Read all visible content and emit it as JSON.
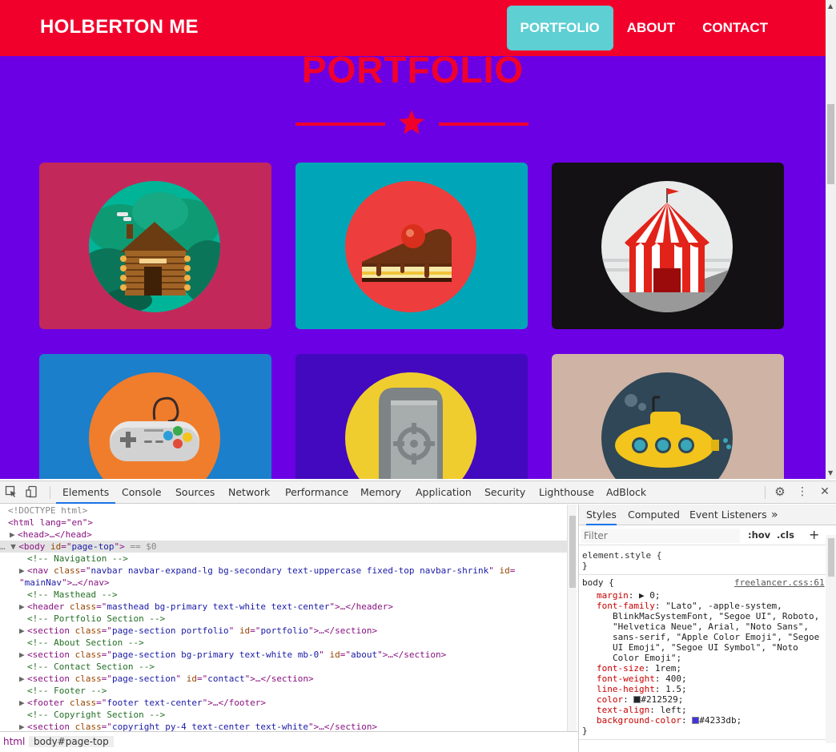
{
  "site": {
    "brand": "HOLBERTON ME",
    "nav": [
      {
        "label": "PORTFOLIO",
        "active": true
      },
      {
        "label": "ABOUT",
        "active": false
      },
      {
        "label": "CONTACT",
        "active": false
      }
    ],
    "section_title": "PORTFOLIO",
    "colors": {
      "navbar": "#f1002c",
      "body": "#6c00e4",
      "accent": "#5ecfd3"
    },
    "cards": [
      {
        "name": "cabin",
        "bg": "#c2295a"
      },
      {
        "name": "cake",
        "bg": "#00a6b8"
      },
      {
        "name": "circus",
        "bg": "#141114"
      },
      {
        "name": "game",
        "bg": "#1b7fcb"
      },
      {
        "name": "safe",
        "bg": "#4209bf"
      },
      {
        "name": "submarine",
        "bg": "#cfb3a5"
      }
    ]
  },
  "devtools": {
    "tabs": [
      "Elements",
      "Console",
      "Sources",
      "Network",
      "Performance",
      "Memory",
      "Application",
      "Security",
      "Lighthouse",
      "AdBlock"
    ],
    "active_tab": "Elements",
    "dom": {
      "doctype": "<!DOCTYPE html>",
      "html_open": "<html lang=\"en\">",
      "head": "<head>…</head>",
      "body_marker": "== $0",
      "comments": [
        "<!-- Navigation -->",
        "<!-- Masthead -->",
        "<!-- Portfolio Section -->",
        "<!-- About Section -->",
        "<!-- Contact Section -->",
        "<!-- Footer -->",
        "<!-- Copyright Section -->"
      ],
      "nav_class": "navbar navbar-expand-lg bg-secondary text-uppercase fixed-top navbar-shrink",
      "nav_id": "mainNav",
      "header_class": "masthead bg-primary text-white text-center",
      "portfolio_class": "page-section portfolio",
      "portfolio_id": "portfolio",
      "about_class": "page-section bg-primary text-white mb-0",
      "about_id": "about",
      "contact_class": "page-section",
      "contact_id": "contact",
      "footer_class": "footer text-center",
      "copyright_class": "copyright py-4 text-center text-white"
    },
    "breadcrumb": [
      "html",
      "body#page-top"
    ],
    "styles_tabs": [
      "Styles",
      "Computed",
      "Event Listeners",
      "»"
    ],
    "filter_placeholder": "Filter",
    "hov": ":hov",
    "cls": ".cls",
    "element_style": "element.style {",
    "rule_selector": "body {",
    "rule_source": "freelancer.css:61",
    "props": {
      "margin": "0;",
      "font_family_lines": [
        "\"Lato\", -apple-system,",
        "BlinkMacSystemFont, \"Segoe UI\", Roboto,",
        "\"Helvetica Neue\", Arial, \"Noto Sans\",",
        "sans-serif, \"Apple Color Emoji\", \"Segoe",
        "UI Emoji\", \"Segoe UI Symbol\", \"Noto",
        "Color Emoji\";"
      ],
      "font_size": "1rem;",
      "font_weight": "400;",
      "line_height": "1.5;",
      "color": "#212529;",
      "text_align": "left;",
      "background_color": "#4233db;"
    },
    "swatch_colors": {
      "color": "#212529",
      "background": "#4233db"
    }
  }
}
